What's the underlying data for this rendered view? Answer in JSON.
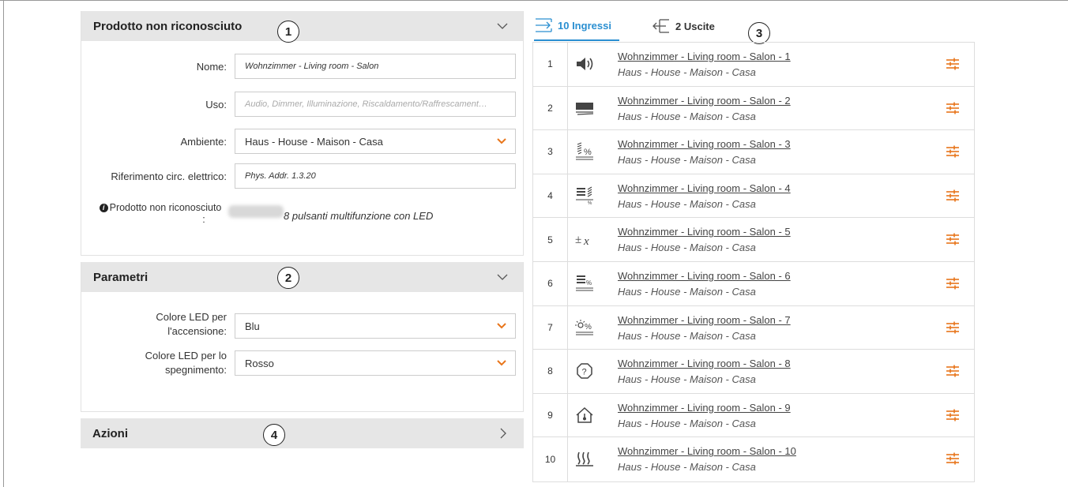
{
  "product_panel": {
    "title": "Prodotto non riconosciuto",
    "callout": "1",
    "name_label": "Nome:",
    "name_value": "Wohnzimmer - Living room - Salon",
    "use_label": "Uso:",
    "use_placeholder": "Audio, Dimmer, Illuminazione, Riscaldamento/Raffrescament…",
    "room_label": "Ambiente:",
    "room_value": "Haus - House - Maison - Casa",
    "circuit_label": "Riferimento circ. elettrico:",
    "circuit_value": "Phys. Addr. 1.3.20",
    "info_label_line1": "Prodotto non riconosciuto",
    "info_label_line2": ":",
    "info_value": "8 pulsanti multifunzione con LED"
  },
  "params_panel": {
    "title": "Parametri",
    "callout": "2",
    "led_on_label_line1": "Colore LED per",
    "led_on_label_line2": "l'accensione:",
    "led_on_value": "Blu",
    "led_off_label_line1": "Colore LED per lo",
    "led_off_label_line2": "spegnimento:",
    "led_off_value": "Rosso"
  },
  "actions_panel": {
    "title": "Azioni",
    "callout": "4"
  },
  "tabs": {
    "inputs_label": "10 Ingressi",
    "outputs_label": "2 Uscite",
    "callout": "3"
  },
  "inputs": [
    {
      "num": "1",
      "icon": "speaker-icon",
      "name": "Wohnzimmer - Living room - Salon - 1",
      "location": "Haus - House - Maison - Casa"
    },
    {
      "num": "2",
      "icon": "blind-icon",
      "name": "Wohnzimmer - Living room - Salon - 2",
      "location": "Haus - House - Maison - Casa"
    },
    {
      "num": "3",
      "icon": "dimmer-percent-icon",
      "name": "Wohnzimmer - Living room - Salon - 3",
      "location": "Haus - House - Maison - Casa"
    },
    {
      "num": "4",
      "icon": "blind-dimmer-icon",
      "name": "Wohnzimmer - Living room - Salon - 4",
      "location": "Haus - House - Maison - Casa"
    },
    {
      "num": "5",
      "icon": "plus-minus-x-icon",
      "name": "Wohnzimmer - Living room - Salon - 5",
      "location": "Haus - House - Maison - Casa"
    },
    {
      "num": "6",
      "icon": "blind-percent-icon",
      "name": "Wohnzimmer - Living room - Salon - 6",
      "location": "Haus - House - Maison - Casa"
    },
    {
      "num": "7",
      "icon": "light-percent-icon",
      "name": "Wohnzimmer - Living room - Salon - 7",
      "location": "Haus - House - Maison - Casa"
    },
    {
      "num": "8",
      "icon": "unknown-icon",
      "name": "Wohnzimmer - Living room - Salon - 8",
      "location": "Haus - House - Maison - Casa"
    },
    {
      "num": "9",
      "icon": "house-temperature-icon",
      "name": "Wohnzimmer - Living room - Salon - 9",
      "location": "Haus - House - Maison - Casa"
    },
    {
      "num": "10",
      "icon": "heating-icon",
      "name": "Wohnzimmer - Living room - Salon - 10",
      "location": "Haus - House - Maison - Casa"
    }
  ],
  "colors": {
    "accent_blue": "#2a8fd1",
    "accent_orange": "#e8751a",
    "panel_header_bg": "#e6e6e6"
  }
}
